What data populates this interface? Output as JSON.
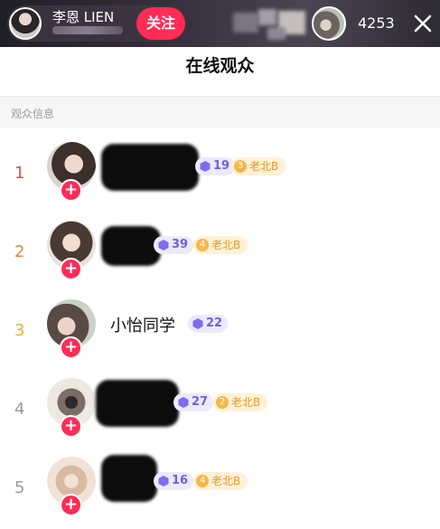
{
  "topbar": {
    "host_name": "李恩 LIEN",
    "follow_label": "关注",
    "viewer_count": "4253"
  },
  "panel": {
    "title": "在线观众",
    "section_label": "观众信息"
  },
  "audience": [
    {
      "rank": "1",
      "name": "",
      "level": "19",
      "fan_level": "3",
      "fan_club": "老北B",
      "rank_color": "#e0503c"
    },
    {
      "rank": "2",
      "name": "",
      "level": "39",
      "fan_level": "4",
      "fan_club": "老北B",
      "rank_color": "#e3843a"
    },
    {
      "rank": "3",
      "name": "小怡同学",
      "level": "22",
      "fan_level": "",
      "fan_club": "",
      "rank_color": "#e8b43a"
    },
    {
      "rank": "4",
      "name": "",
      "level": "27",
      "fan_level": "2",
      "fan_club": "老北B",
      "rank_color": "#9a9a9a"
    },
    {
      "rank": "5",
      "name": "",
      "level": "16",
      "fan_level": "4",
      "fan_club": "老北B",
      "rank_color": "#9a9a9a"
    }
  ],
  "icons": {
    "close": "close-icon",
    "plus": "follow-plus-icon",
    "level": "hexagon-level-icon"
  },
  "colors": {
    "accent": "#ff2c55",
    "level_badge_bg": "#eceafc",
    "level_badge_text": "#6f5fe0",
    "fan_badge_bg": "#fff1d6",
    "fan_badge_text": "#e49b2b"
  }
}
